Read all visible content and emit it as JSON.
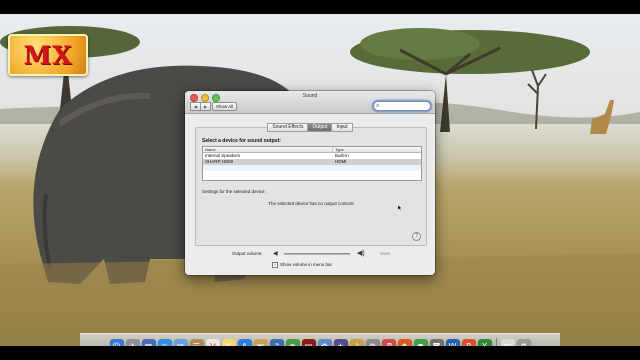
{
  "watermark": {
    "text": "MX"
  },
  "window": {
    "title": "Sound",
    "toolbar": {
      "back_glyph": "◀",
      "forward_glyph": "▶",
      "show_all_label": "Show All",
      "search_value": "",
      "search_icon": "search-icon"
    },
    "tabs": [
      {
        "label": "Sound Effects",
        "active": false
      },
      {
        "label": "Output",
        "active": true
      },
      {
        "label": "Input",
        "active": false
      }
    ],
    "output": {
      "heading": "Select a device for sound output:",
      "columns": [
        "Name",
        "Type"
      ],
      "devices": [
        {
          "name": "Internal Speakers",
          "type": "Built-in"
        },
        {
          "name": "SHARP HDMI",
          "type": "HDMI"
        }
      ],
      "settings_label": "Settings for the selected device:",
      "no_controls_text": "The selected device has no output controls",
      "help_glyph": "?"
    },
    "volume": {
      "label": "Output volume:",
      "mute_label": "Mute",
      "level": 0
    },
    "menu_bar": {
      "checked": true,
      "label": "Show volume in menu bar"
    }
  },
  "dock": {
    "apps": [
      {
        "icon": "finder-icon",
        "glyph": "☺",
        "color": "#3a78d8"
      },
      {
        "icon": "launchpad-icon",
        "glyph": "✈",
        "color": "#8a8f98"
      },
      {
        "icon": "mission-control-icon",
        "glyph": "▦",
        "color": "#4b6bb5"
      },
      {
        "icon": "safari-icon",
        "glyph": "◎",
        "color": "#2f8fe0"
      },
      {
        "icon": "mail-icon",
        "glyph": "✉",
        "color": "#6aa0d9"
      },
      {
        "icon": "contacts-icon",
        "glyph": "☰",
        "color": "#b08a5a"
      },
      {
        "icon": "calendar-icon",
        "glyph": "24",
        "color": "#e8e8e8"
      },
      {
        "icon": "notes-icon",
        "glyph": "✎",
        "color": "#f1d873"
      },
      {
        "icon": "app-store-icon",
        "glyph": "A",
        "color": "#2f7ed8"
      },
      {
        "icon": "preview-icon",
        "glyph": "▣",
        "color": "#c5a05a"
      },
      {
        "icon": "itunes-icon",
        "glyph": "♫",
        "color": "#3a6fb0"
      },
      {
        "icon": "facetime-icon",
        "glyph": "◉",
        "color": "#4a9a4a"
      },
      {
        "icon": "photo-booth-icon",
        "glyph": "▤",
        "color": "#8b1c1c"
      },
      {
        "icon": "iphoto-icon",
        "glyph": "✿",
        "color": "#5e8cc8"
      },
      {
        "icon": "imovie-icon",
        "glyph": "★",
        "color": "#5b4a8c"
      },
      {
        "icon": "garageband-icon",
        "glyph": "♪",
        "color": "#c8a24a"
      },
      {
        "icon": "system-preferences-icon",
        "glyph": "⚙",
        "color": "#8a8a8a"
      },
      {
        "icon": "music-icon",
        "glyph": "♬",
        "color": "#d24a4a"
      },
      {
        "icon": "photo-icon",
        "glyph": "❖",
        "color": "#d85a2a"
      },
      {
        "icon": "chrome-icon",
        "glyph": "●",
        "color": "#3fa04a"
      },
      {
        "icon": "utility-icon",
        "glyph": "◙",
        "color": "#707070"
      },
      {
        "icon": "word-icon",
        "glyph": "W",
        "color": "#2b5fb4"
      },
      {
        "icon": "powerpoint-icon",
        "glyph": "P",
        "color": "#d2552b"
      },
      {
        "icon": "excel-icon",
        "glyph": "X",
        "color": "#2f8a3c"
      }
    ],
    "docs": [
      {
        "icon": "document-icon",
        "glyph": "▤",
        "color": "#d8d8d8"
      },
      {
        "icon": "trash-icon",
        "glyph": "♻",
        "color": "#9a9a9a"
      }
    ]
  }
}
